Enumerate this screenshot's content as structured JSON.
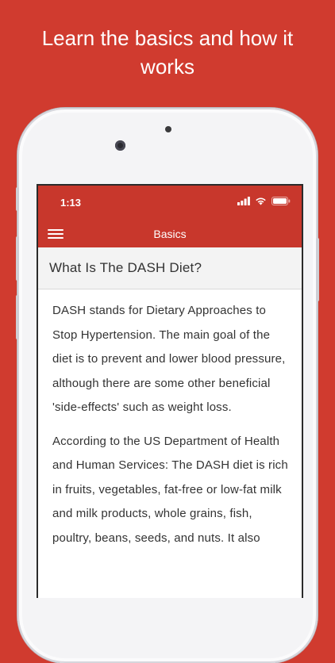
{
  "promo": {
    "headline_line1": "Learn the basics and how it",
    "headline_line2": "works"
  },
  "status_bar": {
    "time": "1:13",
    "icons": [
      "cellular-signal-icon",
      "wifi-icon",
      "battery-icon"
    ]
  },
  "app_bar": {
    "menu_icon": "hamburger-menu-icon",
    "title": "Basics"
  },
  "section": {
    "title": "What Is The DASH Diet?"
  },
  "article": {
    "paragraphs": [
      "DASH stands for Dietary Approaches to Stop Hypertension. The main goal of the diet is to prevent and lower blood pressure, although there are some other beneficial 'side-effects' such as weight loss.",
      "According to the US Department of Health and Human Services: The DASH diet is rich in fruits, vegetables, fat-free or low-fat milk and milk products, whole grains, fish, poultry, beans, seeds, and nuts. It also"
    ]
  },
  "colors": {
    "background": "#d03b2f",
    "app_bar": "#c8372c",
    "section_header_bg": "#f3f3f3",
    "text": "#333333"
  }
}
